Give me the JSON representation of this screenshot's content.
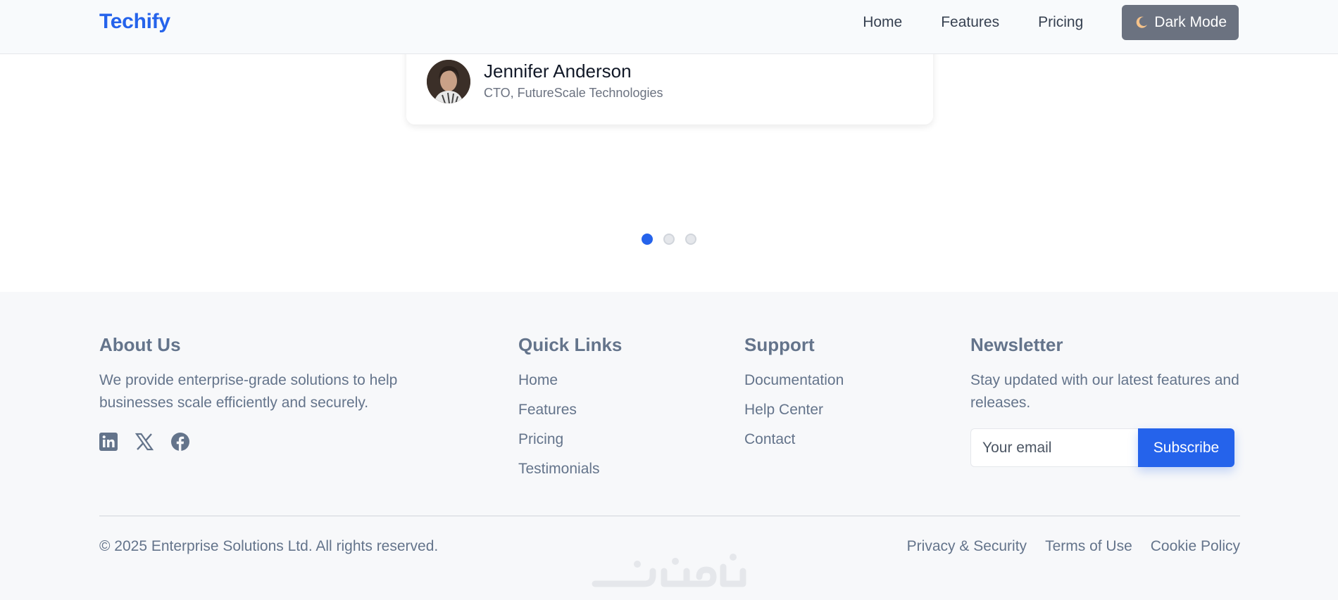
{
  "navbar": {
    "brand": "Techify",
    "links": [
      "Home",
      "Features",
      "Pricing"
    ],
    "dark_mode_label": "Dark Mode",
    "colors": {
      "brand": "#2563eb",
      "dark_mode_button": "#6b7280"
    }
  },
  "testimonial": {
    "author_name": "Jennifer Anderson",
    "author_role": "CTO, FutureScale Technologies",
    "carousel": {
      "total": 3,
      "active_index": 0
    }
  },
  "footer": {
    "about": {
      "title": "About Us",
      "text": "We provide enterprise-grade solutions to help businesses scale efficiently and securely.",
      "social_icons": [
        "linkedin-icon",
        "x-icon",
        "facebook-icon"
      ]
    },
    "quick_links": {
      "title": "Quick Links",
      "items": [
        "Home",
        "Features",
        "Pricing",
        "Testimonials"
      ]
    },
    "support": {
      "title": "Support",
      "items": [
        "Documentation",
        "Help Center",
        "Contact"
      ]
    },
    "newsletter": {
      "title": "Newsletter",
      "text": "Stay updated with our latest features and releases.",
      "email_placeholder": "Your email",
      "subscribe_label": "Subscribe"
    },
    "copyright": "© 2025 Enterprise Solutions Ltd. All rights reserved.",
    "legal_links": [
      "Privacy & Security",
      "Terms of Use",
      "Cookie Policy"
    ],
    "watermark": "خمسات"
  }
}
